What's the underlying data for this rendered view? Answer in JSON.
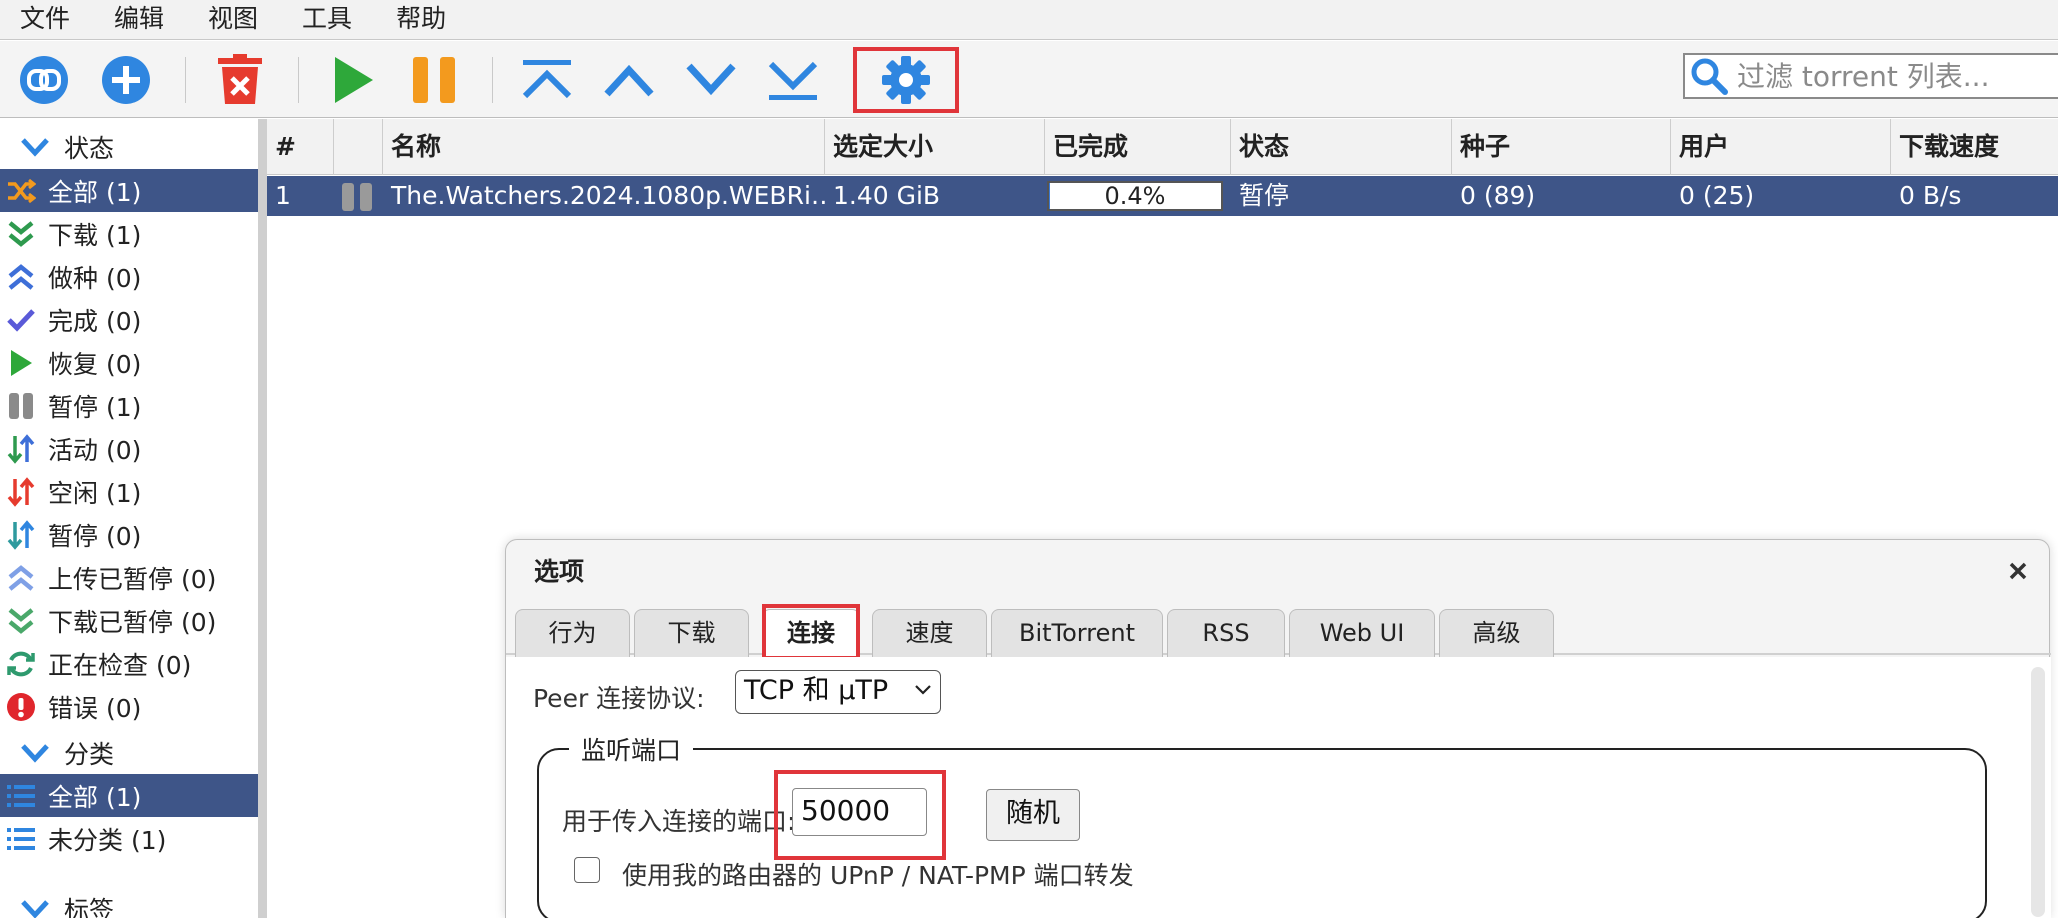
{
  "menu": [
    "文件",
    "编辑",
    "视图",
    "工具",
    "帮助"
  ],
  "toolbar": {
    "buttons": [
      "link-icon",
      "add-icon",
      "delete-icon",
      "play-icon",
      "pause-icon",
      "move-top-icon",
      "move-up-icon",
      "move-down-icon",
      "move-bottom-icon",
      "gear-icon"
    ],
    "filter_placeholder": "过滤 torrent 列表..."
  },
  "sidebar": {
    "status_header": "状态",
    "status_items": [
      {
        "label": "全部 (1)",
        "icon": "shuffle-icon",
        "selected": true
      },
      {
        "label": "下载 (1)",
        "icon": "double-down-icon"
      },
      {
        "label": "做种 (0)",
        "icon": "double-up-icon"
      },
      {
        "label": "完成 (0)",
        "icon": "check-icon"
      },
      {
        "label": "恢复 (0)",
        "icon": "play-icon"
      },
      {
        "label": "暂停 (1)",
        "icon": "pause-icon"
      },
      {
        "label": "活动 (0)",
        "icon": "updown-arrows-icon"
      },
      {
        "label": "空闲 (1)",
        "icon": "updown-arrows-red-icon"
      },
      {
        "label": "暂停 (0)",
        "icon": "updown-arrows-icon"
      },
      {
        "label": "上传已暂停 (0)",
        "icon": "double-up-light-icon"
      },
      {
        "label": "下载已暂停 (0)",
        "icon": "double-down-light-icon"
      },
      {
        "label": "正在检查 (0)",
        "icon": "refresh-icon"
      },
      {
        "label": "错误 (0)",
        "icon": "error-icon"
      }
    ],
    "category_header": "分类",
    "category_items": [
      {
        "label": "全部 (1)",
        "icon": "list-icon",
        "selected": true
      },
      {
        "label": "未分类 (1)",
        "icon": "list-icon"
      }
    ],
    "tags_header": "标签"
  },
  "table": {
    "columns": [
      "#",
      "",
      "名称",
      "选定大小",
      "已完成",
      "状态",
      "种子",
      "用户",
      "下载速度"
    ],
    "rows": [
      {
        "num": "1",
        "name": "The.Watchers.2024.1080p.WEBRi…",
        "size": "1.40 GiB",
        "progress_text": "0.4%",
        "progress": 0.004,
        "status": "暂停",
        "seeds": "0 (89)",
        "peers": "0 (25)",
        "speed": "0 B/s"
      }
    ]
  },
  "dialog": {
    "title": "选项",
    "tabs": [
      "行为",
      "下载",
      "连接",
      "速度",
      "BitTorrent",
      "RSS",
      "Web UI",
      "高级"
    ],
    "active_tab": "连接",
    "peer_label": "Peer 连接协议:",
    "peer_value": "TCP 和 μTP",
    "listen_legend": "监听端口",
    "port_label": "用于传入连接的端口:",
    "port_value": "50000",
    "random_label": "随机",
    "upnp_label": "使用我的路由器的 UPnP / NAT-PMP 端口转发",
    "upnp_checked": false
  },
  "colors": {
    "accent": "#3e5588",
    "highlight": "#e0353a",
    "blue_icon": "#2f86e0"
  }
}
